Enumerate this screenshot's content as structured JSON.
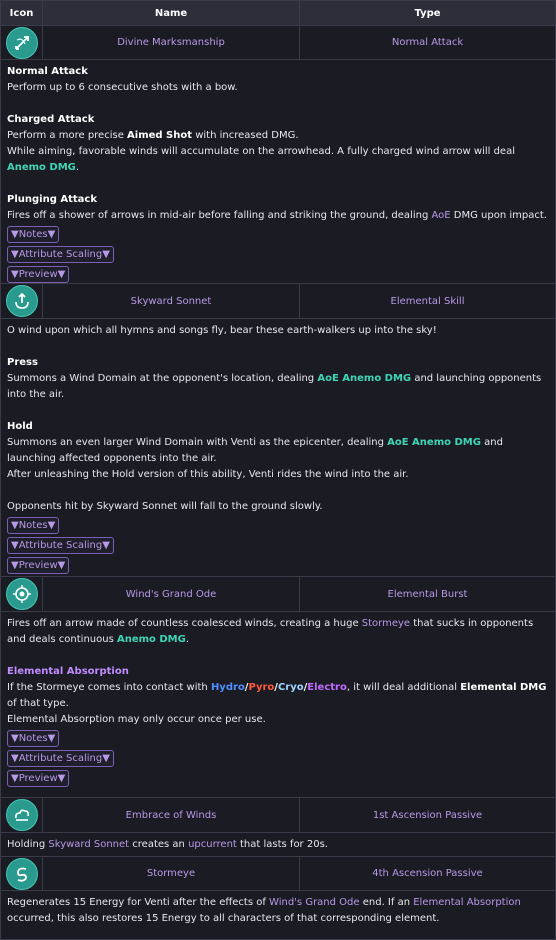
{
  "table": {
    "headers": {
      "icon": "Icon",
      "name": "Name",
      "type": "Type"
    }
  },
  "toggles": {
    "notes": "▼Notes▼",
    "scaling": "▼Attribute Scaling▼",
    "preview": "▼Preview▼"
  },
  "talents": [
    {
      "name": "Divine Marksmanship",
      "type": "Normal Attack",
      "icon": "bow-icon",
      "na_title": "Normal Attack",
      "na_text": "Perform up to 6 consecutive shots with a bow.",
      "ca_title": "Charged Attack",
      "ca_1a": "Perform a more precise ",
      "ca_1b": "Aimed Shot",
      "ca_1c": " with increased DMG.",
      "ca_2a": "While aiming, favorable winds will accumulate on the arrowhead. A fully charged wind arrow will deal ",
      "ca_2b": "Anemo DMG",
      "ca_2c": ".",
      "pa_title": "Plunging Attack",
      "pa_a": "Fires off a shower of arrows in mid-air before falling and striking the ground, dealing ",
      "pa_b": "AoE",
      "pa_c": " DMG upon impact."
    },
    {
      "name": "Skyward Sonnet",
      "type": "Elemental Skill",
      "icon": "wind-skill-icon",
      "intro": "O wind upon which all hymns and songs fly, bear these earth-walkers up into the sky!",
      "press_title": "Press",
      "press_a": "Summons a Wind Domain at the opponent's location, dealing ",
      "press_b": "AoE Anemo DMG",
      "press_c": " and launching opponents into the air.",
      "hold_title": "Hold",
      "hold_a": "Summons an even larger Wind Domain with Venti as the epicenter, dealing ",
      "hold_b": "AoE Anemo DMG",
      "hold_c": " and launching affected opponents into the air.",
      "hold_2": "After unleashing the Hold version of this ability, Venti rides the wind into the air.",
      "outro": "Opponents hit by Skyward Sonnet will fall to the ground slowly."
    },
    {
      "name": "Wind's Grand Ode",
      "type": "Elemental Burst",
      "icon": "vortex-burst-icon",
      "a": "Fires off an arrow made of countless coalesced winds, creating a huge ",
      "b": "Stormeye",
      "c": " that sucks in opponents and deals continuous ",
      "d": "Anemo DMG",
      "e": ".",
      "abs_title": "Elemental Absorption",
      "abs_a": "If the Stormeye comes into contact with ",
      "hydro": "Hydro",
      "pyro": "Pyro",
      "cryo": "Cryo",
      "electro": "Electro",
      "slash": "/",
      "abs_b": ", it will deal additional ",
      "abs_c": "Elemental DMG",
      "abs_d": " of that type.",
      "abs_2": "Elemental Absorption may only occur once per use."
    },
    {
      "name": "Embrace of Winds",
      "type": "1st Ascension Passive",
      "icon": "cloud-passive-icon",
      "a": "Holding ",
      "b": "Skyward Sonnet",
      "c": " creates an ",
      "d": "upcurrent",
      "e": " that lasts for 20s."
    },
    {
      "name": "Stormeye",
      "type": "4th Ascension Passive",
      "icon": "swirl-passive-icon",
      "a": "Regenerates 15 Energy for Venti after the effects of ",
      "b": "Wind's Grand Ode",
      "c": " end. If an ",
      "d": "Elemental Absorption",
      "e": " occurred, this also restores 15 Energy to all characters of that corresponding element."
    }
  ],
  "colors": {
    "anemo": "#3ed6b6",
    "link": "#b899e6",
    "hydro": "#4f8fff",
    "pyro": "#ff5a3a",
    "electro": "#c06bff"
  }
}
